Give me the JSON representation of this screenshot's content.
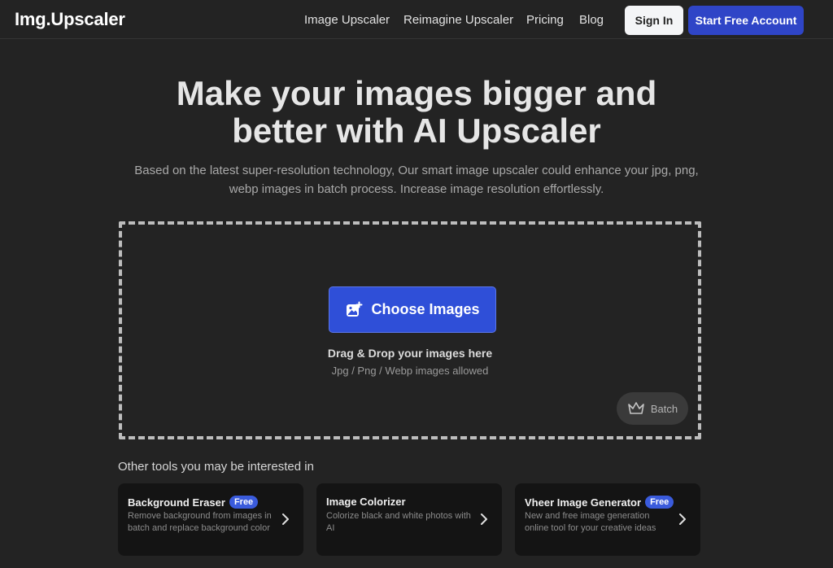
{
  "nav": {
    "logo": "Img.Upscaler",
    "links": [
      "Image Upscaler",
      "Reimagine Upscaler",
      "Pricing",
      "Blog"
    ],
    "signin_label": "Sign In",
    "start_label": "Start Free Account"
  },
  "hero": {
    "title_line1": "Make your images bigger and",
    "title_line2": "better with AI Upscaler",
    "subtitle_line1": "Based on the latest super-resolution technology, Our smart image upscaler could enhance your jpg, png,",
    "subtitle_line2": "webp images in batch process. Increase image resolution effortlessly."
  },
  "dropzone": {
    "choose_label": "Choose Images",
    "drop_title": "Drag & Drop your images here",
    "drop_sub": "Jpg / Png / Webp images allowed",
    "batch_label": "Batch"
  },
  "tools": {
    "heading": "Other tools you may be interested in",
    "items": [
      {
        "title": "Background Eraser",
        "badge": "Free",
        "desc": "Remove background from images in batch and replace background color"
      },
      {
        "title": "Image Colorizer",
        "badge": "",
        "desc": "Colorize black and white photos with AI"
      },
      {
        "title": "Vheer Image Generator",
        "badge": "Free",
        "desc": "New and free image generation online tool for your creative ideas"
      }
    ]
  },
  "colors": {
    "background": "#232323",
    "accent": "#2f45c7",
    "card": "#141414"
  },
  "icons": {
    "choose": "image-add-icon",
    "batch": "crown-icon",
    "chevron": "chevron-right-icon"
  }
}
